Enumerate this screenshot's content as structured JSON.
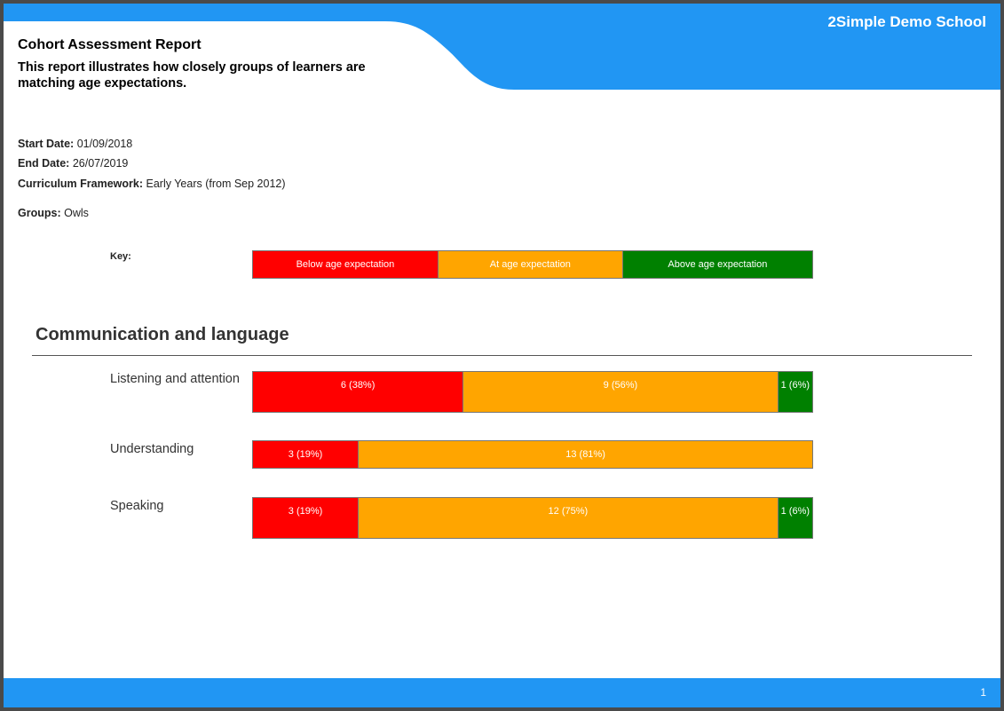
{
  "header": {
    "school_name": "2Simple Demo School",
    "title": "Cohort Assessment Report",
    "subtitle": "This report illustrates how closely groups of learners are matching age expectations."
  },
  "meta": {
    "start_label": "Start Date:",
    "start_value": "01/09/2018",
    "end_label": "End Date:",
    "end_value": "26/07/2019",
    "framework_label": "Curriculum Framework:",
    "framework_value": "Early Years (from Sep 2012)",
    "groups_label": "Groups:",
    "groups_value": "Owls"
  },
  "key": {
    "label": "Key:",
    "below": "Below age expectation",
    "at": "At age expectation",
    "above": "Above age expectation"
  },
  "colors": {
    "brand": "#2196f3",
    "below": "#ff0000",
    "at": "#ffa500",
    "above": "#008000"
  },
  "section": {
    "title": "Communication and language"
  },
  "chart_data": {
    "type": "bar",
    "stacked": true,
    "orientation": "horizontal",
    "categories": [
      "Listening and attention",
      "Understanding",
      "Speaking"
    ],
    "series": [
      {
        "name": "Below age expectation",
        "values": [
          6,
          3,
          3
        ],
        "labels": [
          "6 (38%)",
          "3 (19%)",
          "3 (19%)"
        ]
      },
      {
        "name": "At age expectation",
        "values": [
          9,
          13,
          12
        ],
        "labels": [
          "9 (56%)",
          "13 (81%)",
          "12 (75%)"
        ]
      },
      {
        "name": "Above age expectation",
        "values": [
          1,
          0,
          1
        ],
        "labels": [
          "1 (6%)",
          "",
          "1 (6%)"
        ]
      }
    ]
  },
  "footer": {
    "page_number": "1"
  }
}
